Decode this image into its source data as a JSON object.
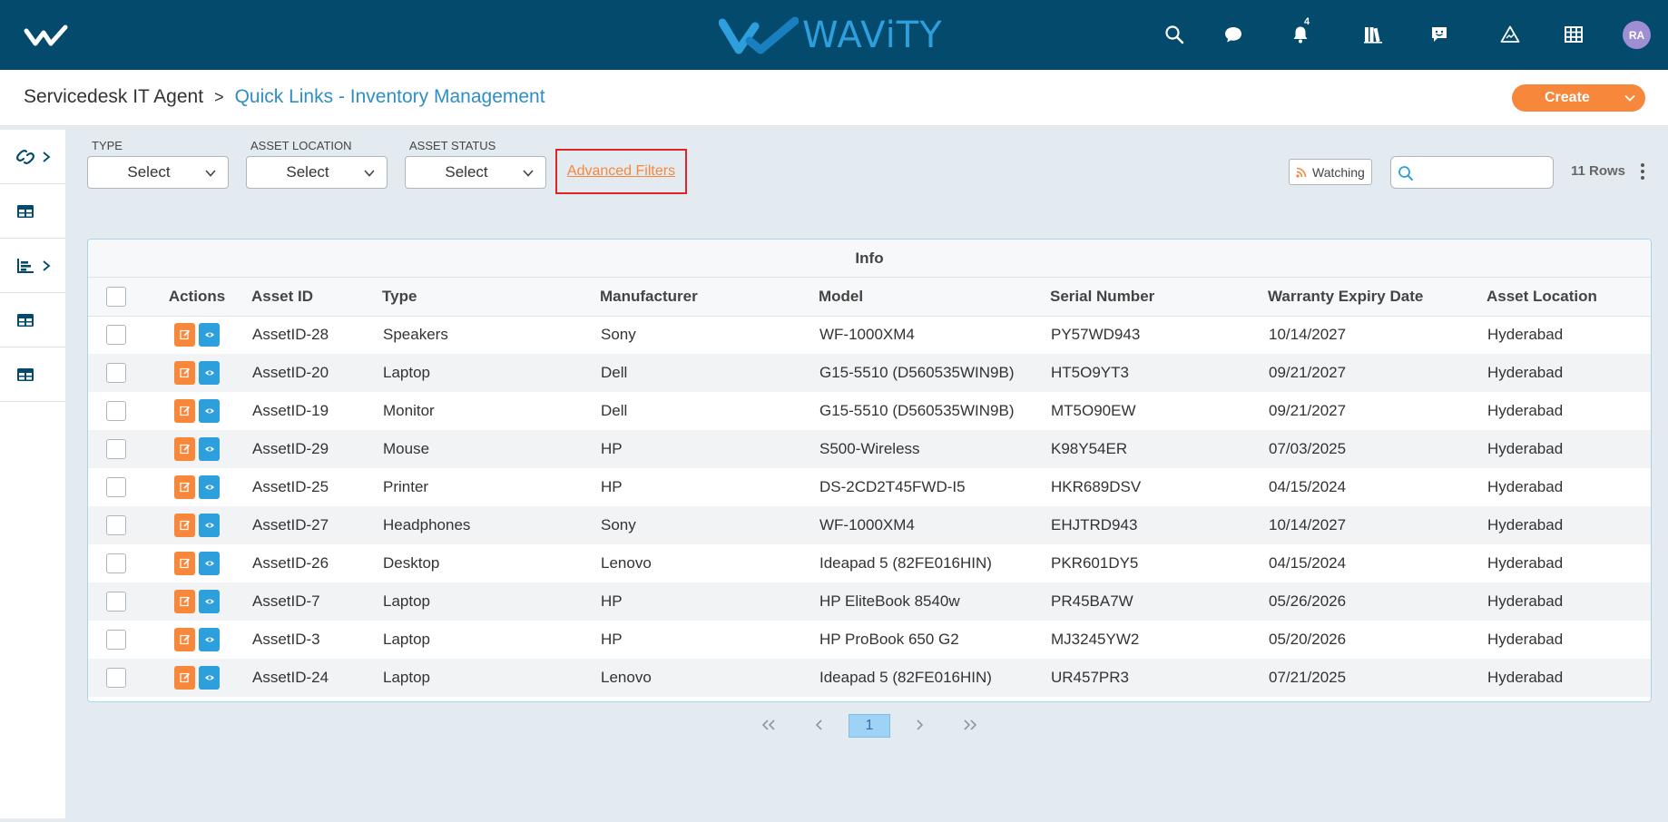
{
  "brand": {
    "name": "WAViTY",
    "primary_color": "#034a6d",
    "accent_color": "#2d9fdc"
  },
  "topnav": {
    "icons": [
      "search-icon",
      "chat-icon",
      "bell-icon",
      "library-icon",
      "feedback-icon",
      "alert-triangle-icon",
      "grid-icon"
    ],
    "notification_count": "4",
    "avatar_initials": "RA"
  },
  "breadcrumb": {
    "root": "Servicedesk IT Agent",
    "separator": ">",
    "current": "Quick Links - Inventory Management"
  },
  "create_label": "Create",
  "filters": {
    "type": {
      "label": "TYPE",
      "value": "Select"
    },
    "location": {
      "label": "ASSET LOCATION",
      "value": "Select"
    },
    "status": {
      "label": "ASSET STATUS",
      "value": "Select"
    },
    "advanced": "Advanced Filters"
  },
  "watching_label": "Watching",
  "search": {
    "placeholder": ""
  },
  "rows_count": "11 Rows",
  "table": {
    "group_header": "Info",
    "columns": [
      "Actions",
      "Asset ID",
      "Type",
      "Manufacturer",
      "Model",
      "Serial Number",
      "Warranty Expiry Date",
      "Asset Location"
    ],
    "rows": [
      [
        "AssetID-28",
        "Speakers",
        "Sony",
        "WF-1000XM4",
        "PY57WD943",
        "10/14/2027",
        "Hyderabad"
      ],
      [
        "AssetID-20",
        "Laptop",
        "Dell",
        "G15-5510 (D560535WIN9B)",
        "HT5O9YT3",
        "09/21/2027",
        "Hyderabad"
      ],
      [
        "AssetID-19",
        "Monitor",
        "Dell",
        "G15-5510 (D560535WIN9B)",
        "MT5O90EW",
        "09/21/2027",
        "Hyderabad"
      ],
      [
        "AssetID-29",
        "Mouse",
        "HP",
        "S500-Wireless",
        "K98Y54ER",
        "07/03/2025",
        "Hyderabad"
      ],
      [
        "AssetID-25",
        "Printer",
        "HP",
        "DS-2CD2T45FWD-I5",
        "HKR689DSV",
        "04/15/2024",
        "Hyderabad"
      ],
      [
        "AssetID-27",
        "Headphones",
        "Sony",
        "WF-1000XM4",
        "EHJTRD943",
        "10/14/2027",
        "Hyderabad"
      ],
      [
        "AssetID-26",
        "Desktop",
        "Lenovo",
        "Ideapad 5 (82FE016HIN)",
        "PKR601DY5",
        "04/15/2024",
        "Hyderabad"
      ],
      [
        "AssetID-7",
        "Laptop",
        "HP",
        "HP EliteBook 8540w",
        "PR45BA7W",
        "05/26/2026",
        "Hyderabad"
      ],
      [
        "AssetID-3",
        "Laptop",
        "HP",
        "HP ProBook 650 G2",
        "MJ3245YW2",
        "05/20/2026",
        "Hyderabad"
      ],
      [
        "AssetID-24",
        "Laptop",
        "Lenovo",
        "Ideapad 5 (82FE016HIN)",
        "UR457PR3",
        "07/21/2025",
        "Hyderabad"
      ]
    ]
  },
  "pagination": {
    "current_page": "1"
  }
}
